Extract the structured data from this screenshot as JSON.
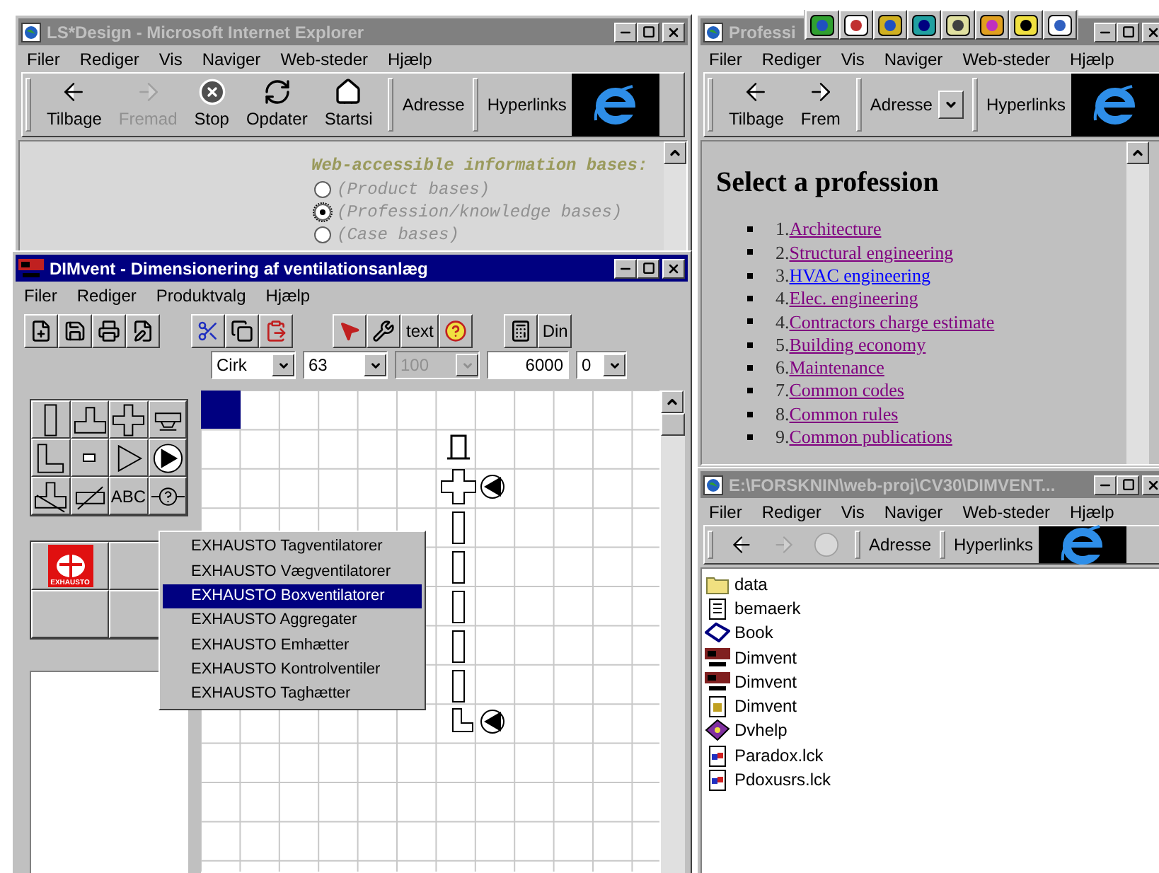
{
  "ls_design_window": {
    "title": "LS*Design - Microsoft Internet Explorer",
    "active": false,
    "menu": [
      "Filer",
      "Rediger",
      "Vis",
      "Naviger",
      "Web-steder",
      "Hjælp"
    ],
    "toolbar": [
      {
        "label": "Tilbage",
        "kind": "back",
        "disabled": false
      },
      {
        "label": "Fremad",
        "kind": "forward",
        "disabled": true
      },
      {
        "label": "Stop",
        "kind": "stop",
        "disabled": false
      },
      {
        "label": "Opdater",
        "kind": "refresh",
        "disabled": false
      },
      {
        "label": "Startsi",
        "kind": "home",
        "disabled": false
      }
    ],
    "address_label": "Adresse",
    "links_label": "Hyperlinks",
    "heading": "Web-accessible information bases:",
    "options": [
      {
        "label": "(Product bases)",
        "selected": false
      },
      {
        "label": "(Profession/knowledge bases)",
        "selected": true
      },
      {
        "label": "(Case bases)",
        "selected": false
      }
    ]
  },
  "profession_window": {
    "title": "Professi",
    "active": false,
    "menu": [
      "Filer",
      "Rediger",
      "Vis",
      "Naviger",
      "Web-steder",
      "Hjælp"
    ],
    "toolbar": [
      {
        "label": "Tilbage",
        "kind": "back",
        "disabled": false
      },
      {
        "label": "Frem",
        "kind": "forward",
        "disabled": false
      }
    ],
    "address_label": "Adresse",
    "links_label": "Hyperlinks",
    "heading": "Select a profession",
    "items": [
      {
        "number": "1.",
        "label": "Architecture",
        "visited": true
      },
      {
        "number": "2.",
        "label": "Structural engineering",
        "visited": true
      },
      {
        "number": "3.",
        "label": "HVAC engineering",
        "visited": false
      },
      {
        "number": "4.",
        "label": "Elec. engineering",
        "visited": true
      },
      {
        "number": "4.",
        "label": "Contractors charge estimate",
        "visited": true
      },
      {
        "number": "5.",
        "label": "Building economy",
        "visited": true
      },
      {
        "number": "6.",
        "label": "Maintenance",
        "visited": true
      },
      {
        "number": "7.",
        "label": "Common codes",
        "visited": true
      },
      {
        "number": "8.",
        "label": "Common rules",
        "visited": true
      },
      {
        "number": "9.",
        "label": "Common publications",
        "visited": true
      }
    ]
  },
  "explorer_window": {
    "title": "E:\\FORSKNIN\\web-proj\\CV30\\DIMVENT...",
    "active": false,
    "menu": [
      "Filer",
      "Rediger",
      "Vis",
      "Naviger",
      "Web-steder",
      "Hjælp"
    ],
    "toolbar": [
      {
        "kind": "back",
        "disabled": false
      },
      {
        "kind": "forward",
        "disabled": true
      },
      {
        "kind": "stop",
        "disabled": true
      }
    ],
    "address_label": "Adresse",
    "links_label": "Hyperlinks",
    "files": [
      {
        "name": "data",
        "kind": "folder"
      },
      {
        "name": "bemaerk",
        "kind": "text"
      },
      {
        "name": "Book",
        "kind": "book"
      },
      {
        "name": "Dimvent",
        "kind": "app"
      },
      {
        "name": "Dimvent",
        "kind": "app"
      },
      {
        "name": "Dimvent",
        "kind": "config"
      },
      {
        "name": "Dvhelp",
        "kind": "help"
      },
      {
        "name": "Paradox.lck",
        "kind": "lock"
      },
      {
        "name": "Pdoxusrs.lck",
        "kind": "lock"
      }
    ]
  },
  "dimvent_window": {
    "title": "DIMvent - Dimensionering af ventilationsanlæg",
    "active": true,
    "menu": [
      "Filer",
      "Rediger",
      "Produktvalg",
      "Hjælp"
    ],
    "text_button": "text",
    "cut_button": "Din",
    "selectors": [
      {
        "value": "Cirk",
        "kind": "combo",
        "disabled": false
      },
      {
        "value": "63",
        "kind": "combo",
        "disabled": false
      },
      {
        "value": "100",
        "kind": "combo",
        "disabled": true
      },
      {
        "value": "6000",
        "kind": "field",
        "disabled": false
      },
      {
        "value": "0",
        "kind": "combo",
        "disabled": false
      }
    ],
    "tool_label": "ABC",
    "logo_text": "EXHAUSTO",
    "popup_menu": [
      {
        "label": "EXHAUSTO Tagventilatorer",
        "selected": false
      },
      {
        "label": "EXHAUSTO Vægventilatorer",
        "selected": false
      },
      {
        "label": "EXHAUSTO Boxventilatorer",
        "selected": true
      },
      {
        "label": "EXHAUSTO Aggregater",
        "selected": false
      },
      {
        "label": "EXHAUSTO Emhætter",
        "selected": false
      },
      {
        "label": "EXHAUSTO Kontrolventiler",
        "selected": false
      },
      {
        "label": "EXHAUSTO Taghætter",
        "selected": false
      }
    ]
  }
}
